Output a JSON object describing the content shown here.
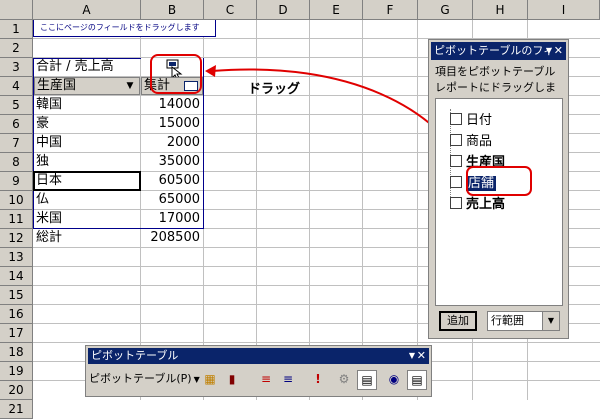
{
  "columns": [
    "A",
    "B",
    "C",
    "D",
    "E",
    "F",
    "G",
    "H",
    "I"
  ],
  "rows": [
    "1",
    "2",
    "3",
    "4",
    "5",
    "6",
    "7",
    "8",
    "9",
    "10",
    "11",
    "12",
    "13",
    "14",
    "15",
    "16",
    "17",
    "18",
    "19",
    "20",
    "21"
  ],
  "page_field_drop_label": "ここにページのフィールドをドラッグします",
  "pivot": {
    "data_field_label": "合計 / 売上高",
    "row_field_label": "生産国",
    "col_field_label": "集計",
    "items": [
      {
        "label": "韓国",
        "value": "14000"
      },
      {
        "label": "豪",
        "value": "15000"
      },
      {
        "label": "中国",
        "value": "2000"
      },
      {
        "label": "独",
        "value": "35000"
      },
      {
        "label": "日本",
        "value": "60500"
      },
      {
        "label": "仏",
        "value": "65000"
      },
      {
        "label": "米国",
        "value": "17000"
      },
      {
        "label": "総計",
        "value": "208500"
      }
    ]
  },
  "annotation": {
    "drag_label": "ドラッグ",
    "accent_color": "#e00000"
  },
  "field_list": {
    "title": "ピボットテーブルのフィ",
    "description": "項目をピボットテーブル レポートにドラッグします",
    "fields": [
      "日付",
      "商品",
      "生産国",
      "店舗",
      "売上高"
    ],
    "selected_field": "店舗",
    "add_button": "追加",
    "area_select": "行範囲"
  },
  "toolbar": {
    "title": "ピボットテーブル",
    "menu_label": "ピボットテーブル(P)"
  },
  "icons": {
    "dropdown": "dropdown-arrow-icon",
    "close": "close-icon",
    "field": "field-item-icon",
    "drag_cursor": "drag-cursor-icon"
  }
}
